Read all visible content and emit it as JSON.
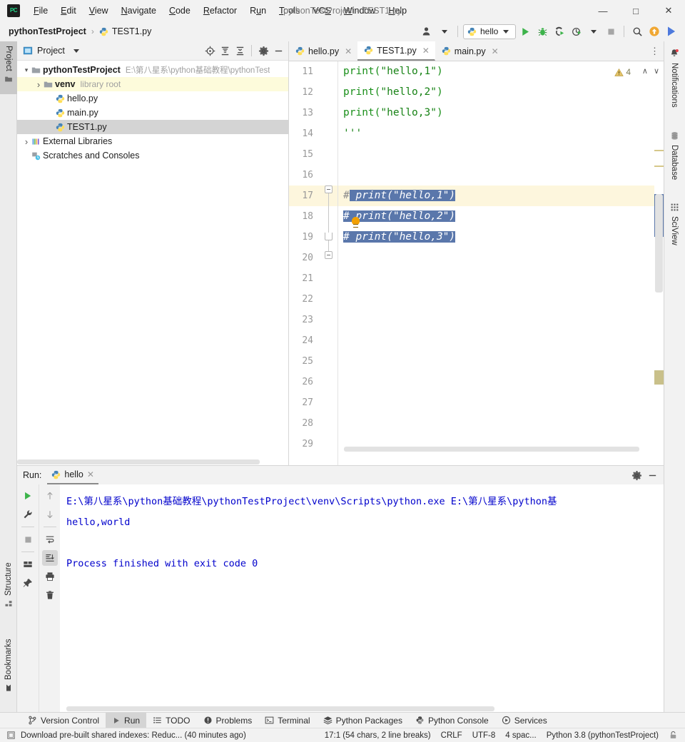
{
  "window": {
    "title": "pythonTestProject - TEST1.py",
    "minimize_label": "—",
    "maximize_label": "□",
    "close_label": "✕"
  },
  "menubar": {
    "logo": "PC",
    "items": [
      {
        "label": "File",
        "mnemonic": "F"
      },
      {
        "label": "Edit",
        "mnemonic": "E"
      },
      {
        "label": "View",
        "mnemonic": "V"
      },
      {
        "label": "Navigate",
        "mnemonic": "N"
      },
      {
        "label": "Code",
        "mnemonic": "C"
      },
      {
        "label": "Refactor",
        "mnemonic": "R"
      },
      {
        "label": "Run",
        "mnemonic": "u"
      },
      {
        "label": "Tools",
        "mnemonic": "T"
      },
      {
        "label": "VCS",
        "mnemonic": "S"
      },
      {
        "label": "Window",
        "mnemonic": "W"
      },
      {
        "label": "Help",
        "mnemonic": "H"
      }
    ]
  },
  "navbar": {
    "project": "pythonTestProject",
    "separator": "›",
    "file": "TEST1.py",
    "run_config": "hello",
    "icons": {
      "account": "account-icon",
      "run": "run-icon",
      "debug": "debug-icon",
      "run_coverage": "run-with-coverage-icon",
      "profile": "profile-icon",
      "stop": "stop-icon",
      "search": "search-icon",
      "update": "update-project-icon",
      "ide_assist": "ide-assistant-icon"
    }
  },
  "left_strip": {
    "tabs": [
      {
        "label": "Project",
        "active": true,
        "icon": "project-folder-icon"
      },
      {
        "label": "Structure",
        "active": false,
        "icon": "structure-icon"
      },
      {
        "label": "Bookmarks",
        "active": false,
        "icon": "bookmark-icon"
      }
    ]
  },
  "right_strip": {
    "tabs": [
      {
        "label": "Notifications",
        "icon": "bell-icon"
      },
      {
        "label": "Database",
        "icon": "database-icon"
      },
      {
        "label": "SciView",
        "icon": "sciview-grid-icon"
      }
    ]
  },
  "project_panel": {
    "title": "Project",
    "header_icons": [
      "locate-icon",
      "expand-all-icon",
      "collapse-all-icon",
      "settings-gear-icon",
      "hide-icon"
    ],
    "tree": [
      {
        "label": "pythonTestProject",
        "path": "E:\\第八星系\\python基础教程\\pythonTest",
        "bold": true,
        "twist": "▾",
        "icon": "folder-icon",
        "indent": 0,
        "state": "normal"
      },
      {
        "label": "venv",
        "sub": "library root",
        "bold": true,
        "twist": "›",
        "icon": "folder-icon",
        "indent": 1,
        "state": "highlight"
      },
      {
        "label": "hello.py",
        "twist": "",
        "icon": "python-file-icon",
        "indent": 2,
        "state": "normal"
      },
      {
        "label": "main.py",
        "twist": "",
        "icon": "python-file-icon",
        "indent": 2,
        "state": "normal"
      },
      {
        "label": "TEST1.py",
        "twist": "",
        "icon": "python-file-icon",
        "indent": 2,
        "state": "selected"
      },
      {
        "label": "External Libraries",
        "twist": "›",
        "icon": "library-icon",
        "indent": 0,
        "state": "normal"
      },
      {
        "label": "Scratches and Consoles",
        "twist": "",
        "icon": "scratches-icon",
        "indent": 0,
        "state": "normal"
      }
    ]
  },
  "editor": {
    "tabs": [
      {
        "label": "hello.py",
        "active": false,
        "icon": "python-file-icon"
      },
      {
        "label": "TEST1.py",
        "active": true,
        "icon": "python-file-icon"
      },
      {
        "label": "main.py",
        "active": false,
        "icon": "python-file-icon"
      }
    ],
    "more_label": "⋮",
    "warning_count": "4",
    "warning_icon": "warning-triangle-icon",
    "prev_label": "∧",
    "next_label": "∨",
    "first_line_number": 11,
    "lines": [
      {
        "num": 11,
        "segments": [
          {
            "text": "print(",
            "cls": "fn"
          },
          {
            "text": "\"hello,1\"",
            "cls": "str"
          },
          {
            "text": ")",
            "cls": "fn"
          }
        ]
      },
      {
        "num": 12,
        "segments": [
          {
            "text": "print(",
            "cls": "fn"
          },
          {
            "text": "\"hello,2\"",
            "cls": "str"
          },
          {
            "text": ")",
            "cls": "fn"
          }
        ]
      },
      {
        "num": 13,
        "segments": [
          {
            "text": "print(",
            "cls": "fn"
          },
          {
            "text": "\"hello,3\"",
            "cls": "str"
          },
          {
            "text": ")",
            "cls": "fn"
          }
        ]
      },
      {
        "num": 14,
        "segments": [
          {
            "text": "'''",
            "cls": "str"
          }
        ]
      },
      {
        "num": 15,
        "segments": []
      },
      {
        "num": 16,
        "segments": []
      },
      {
        "num": 17,
        "segments": [
          {
            "text": "#",
            "cls": "cmt"
          },
          {
            "text": " print(\"hello,1\")",
            "cls": "cmt-sel"
          }
        ],
        "current": true,
        "selected_from": 1
      },
      {
        "num": 18,
        "segments": [
          {
            "text": "# print(\"hello,2\")",
            "cls": "cmt-sel"
          }
        ],
        "selected_from": 0
      },
      {
        "num": 19,
        "segments": [
          {
            "text": "# print(\"hello,3\")",
            "cls": "cmt-sel"
          }
        ],
        "selected_from": 0
      },
      {
        "num": 20,
        "segments": []
      },
      {
        "num": 21,
        "segments": []
      },
      {
        "num": 22,
        "segments": []
      },
      {
        "num": 23,
        "segments": []
      },
      {
        "num": 24,
        "segments": []
      },
      {
        "num": 25,
        "segments": []
      },
      {
        "num": 26,
        "segments": []
      },
      {
        "num": 27,
        "segments": []
      },
      {
        "num": 28,
        "segments": []
      },
      {
        "num": 29,
        "segments": []
      }
    ],
    "selection_color": "#5a77ab",
    "current_line_color": "#fdf6dd",
    "bulb_icon": "intention-bulb-icon"
  },
  "run_panel": {
    "label": "Run:",
    "tab_label": "hello",
    "tab_icon": "python-file-icon",
    "header_icons": [
      "settings-gear-icon",
      "hide-icon"
    ],
    "tools_col1": [
      "rerun-icon",
      "wrench-icon",
      "stop-icon",
      "layout-icon",
      "pin-icon"
    ],
    "tools_col2": [
      "up-arrow-icon",
      "down-arrow-icon",
      "soft-wrap-icon",
      "scroll-to-end-icon",
      "print-icon",
      "trash-icon"
    ],
    "console_lines": [
      "E:\\第八星系\\python基础教程\\pythonTestProject\\venv\\Scripts\\python.exe E:\\第八星系\\python基",
      "hello,world",
      "",
      "Process finished with exit code 0"
    ],
    "console_color": "#0000cc"
  },
  "toolwindow_bar": {
    "items": [
      {
        "label": "Version Control",
        "icon": "branch-icon",
        "active": false
      },
      {
        "label": "Run",
        "icon": "run-icon",
        "active": true
      },
      {
        "label": "TODO",
        "icon": "todo-list-icon",
        "active": false
      },
      {
        "label": "Problems",
        "icon": "problems-icon",
        "active": false
      },
      {
        "label": "Terminal",
        "icon": "terminal-icon",
        "active": false
      },
      {
        "label": "Python Packages",
        "icon": "packages-icon",
        "active": false
      },
      {
        "label": "Python Console",
        "icon": "python-console-icon",
        "active": false
      },
      {
        "label": "Services",
        "icon": "services-icon",
        "active": false
      }
    ]
  },
  "statusbar": {
    "message": "Download pre-built shared indexes: Reduc... (40 minutes ago)",
    "message_icon": "inspection-widget-icon",
    "caret": "17:1 (54 chars, 2 line breaks)",
    "line_separator": "CRLF",
    "encoding": "UTF-8",
    "indent": "4 spac...",
    "interpreter": "Python 3.8 (pythonTestProject)",
    "lock_icon": "lock-icon"
  }
}
